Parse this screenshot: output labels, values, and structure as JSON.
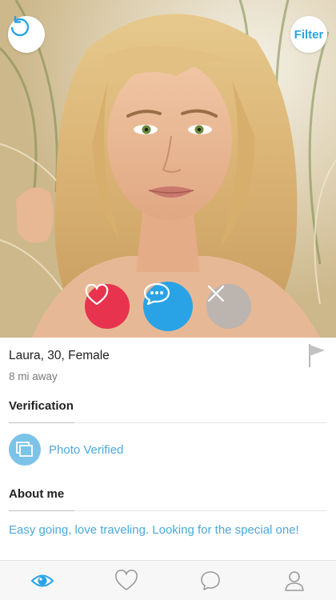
{
  "top_controls": {
    "undo_icon": "undo-arrow-icon",
    "filter_label": "Filter"
  },
  "actions": {
    "like_icon": "heart-icon",
    "chat_icon": "chat-bubble-icon",
    "pass_icon": "close-icon"
  },
  "profile": {
    "name_line": "Laura, 30, Female",
    "distance": "8 mi away",
    "report_icon": "flag-icon"
  },
  "verification": {
    "title": "Verification",
    "item_icon": "photo-stack-icon",
    "item_label": "Photo Verified"
  },
  "about": {
    "title": "About me",
    "text": "Easy going, love traveling. Looking for the special one!"
  },
  "tabbar": {
    "tabs": [
      {
        "icon": "eye-icon",
        "active": true
      },
      {
        "icon": "heart-outline-icon",
        "active": false
      },
      {
        "icon": "chat-outline-icon",
        "active": false
      },
      {
        "icon": "user-icon",
        "active": false
      }
    ]
  },
  "colors": {
    "accent": "#2aa3e6",
    "like": "#e8334f",
    "pass": "#b4b4b4",
    "link_text": "#4aa9da"
  }
}
